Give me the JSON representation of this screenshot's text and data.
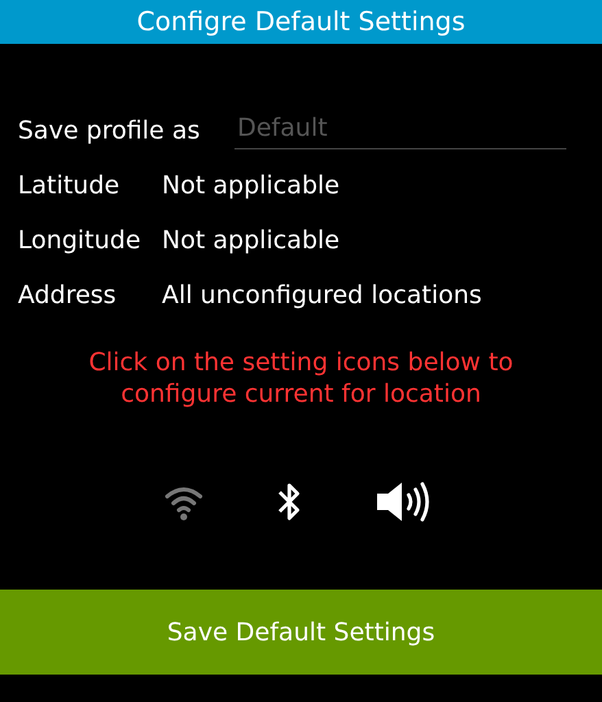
{
  "title": "Configre Default Settings",
  "profile": {
    "label": "Save profile as",
    "placeholder": "Default"
  },
  "fields": [
    {
      "label": "Latitude",
      "value": "Not applicable"
    },
    {
      "label": "Longitude",
      "value": "Not applicable"
    },
    {
      "label": "Address",
      "value": "All unconfigured locations"
    }
  ],
  "hint": "Click on the setting icons below to configure current for location",
  "settings": [
    {
      "kind": "wifi",
      "on": false
    },
    {
      "kind": "bluetooth",
      "on": true
    },
    {
      "kind": "sound",
      "on": true
    }
  ],
  "save_button": "Save Default Settings"
}
